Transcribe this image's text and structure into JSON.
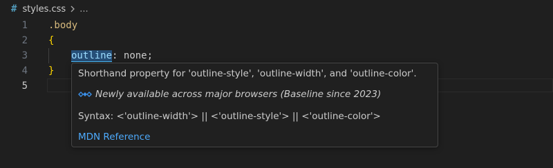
{
  "breadcrumb": {
    "icon": "css-file-icon",
    "filename": "styles.css",
    "ellipsis": "..."
  },
  "editor": {
    "line_numbers": [
      "1",
      "2",
      "3",
      "4",
      "5"
    ],
    "lines": {
      "l1_selector": ".body",
      "l2_open_brace": "{",
      "l3_property": "outline",
      "l3_colon": ":",
      "l3_value": "none",
      "l3_semicolon": ";",
      "l4_close_brace": "}"
    },
    "active_line": "5"
  },
  "hover": {
    "description": "Shorthand property for 'outline-style', 'outline-width', and 'outline-color'.",
    "baseline_icon": "baseline-widely-available-icon",
    "baseline_text": "Newly available across major browsers (Baseline since 2023)",
    "syntax": "Syntax: <'outline-width'> || <'outline-style'> || <'outline-color'>",
    "reference_link": "MDN Reference"
  },
  "colors": {
    "editor_background": "#1f1f1f",
    "selector": "#d7ba7d",
    "brace": "#ffd700",
    "property": "#9cdcfe",
    "link": "#4daafc",
    "baseline_icon": "#3a8ee6"
  }
}
